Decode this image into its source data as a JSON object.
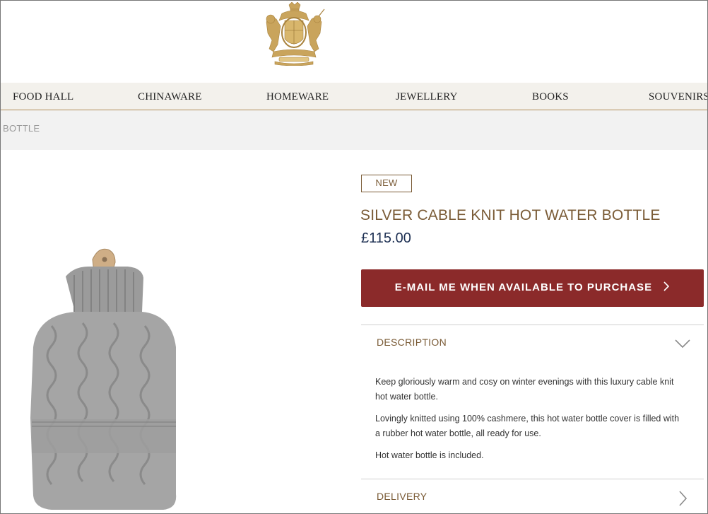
{
  "nav": {
    "items": [
      "FOOD HALL",
      "CHINAWARE",
      "HOMEWARE",
      "JEWELLERY",
      "BOOKS",
      "SOUVENIRS"
    ]
  },
  "breadcrumb": {
    "current": "BOTTLE"
  },
  "product": {
    "badge": "NEW",
    "title": "SILVER CABLE KNIT HOT WATER BOTTLE",
    "price": "£115.00",
    "cta_label": "E-MAIL ME WHEN AVAILABLE TO PURCHASE"
  },
  "description": {
    "heading": "DESCRIPTION",
    "paragraphs": [
      "Keep gloriously warm and cosy on winter evenings with this luxury cable knit hot water bottle.",
      "Lovingly knitted using 100% cashmere, this hot water bottle cover is filled with a rubber hot water bottle, all ready for use.",
      "Hot water bottle is included."
    ]
  },
  "delivery": {
    "heading": "DELIVERY"
  },
  "icons": {
    "crest": "royal-crest-icon",
    "cta_arrow": "chevron-right-icon",
    "description_toggle": "chevron-down-icon",
    "delivery_toggle": "chevron-right-icon"
  },
  "colors": {
    "gold": "#b08d57",
    "brown_text": "#7a5b36",
    "navy_price": "#1c2f52",
    "cta_red": "#8b2a2a",
    "nav_bg": "#f3f1ec"
  }
}
